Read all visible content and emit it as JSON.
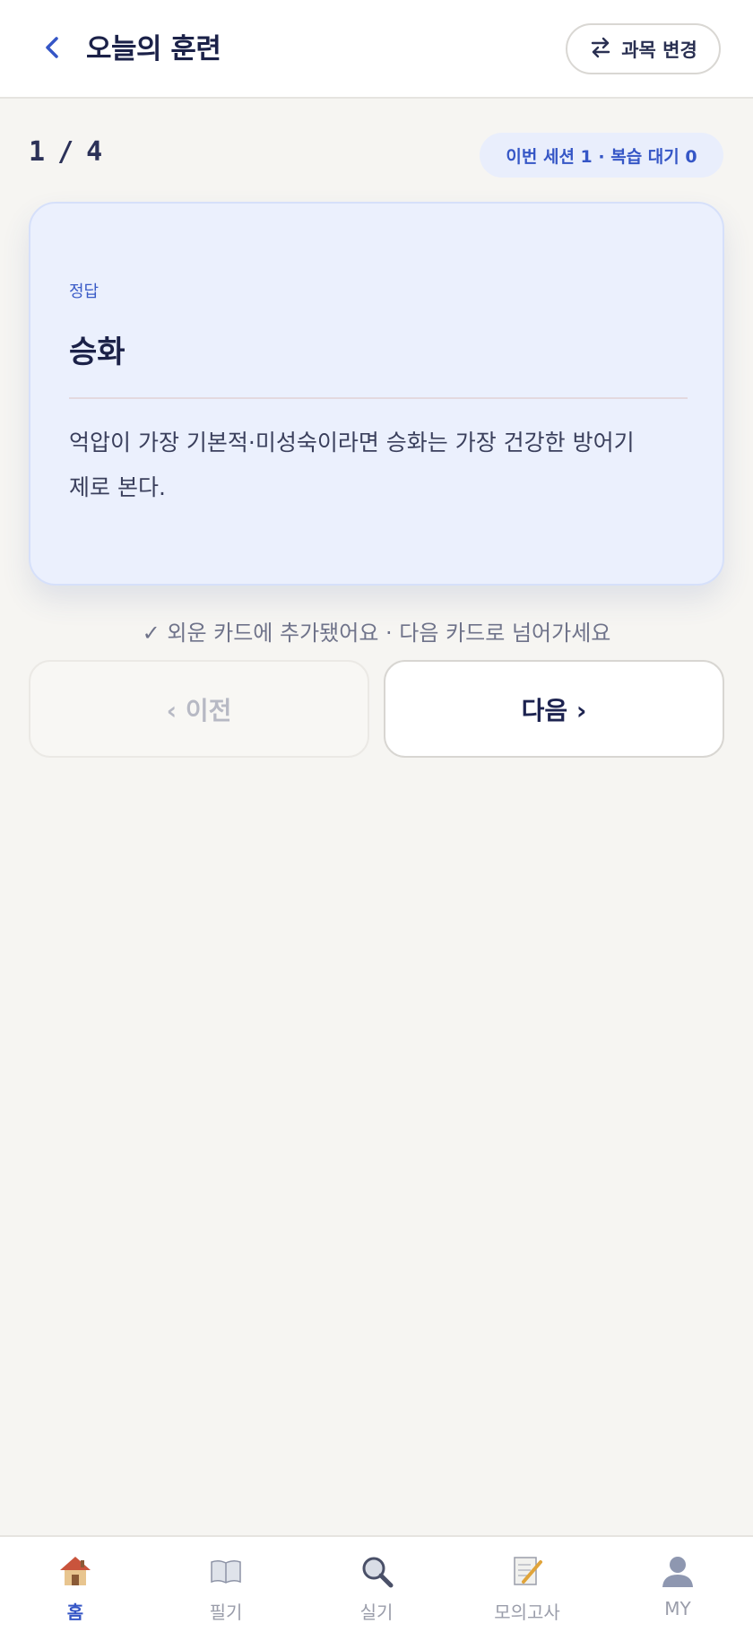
{
  "header": {
    "title": "오늘의 훈련",
    "change_subject_label": "과목 변경"
  },
  "progress": {
    "current": "1",
    "separator": "/",
    "total": "4",
    "session_badge": "이번 세션 1 · 복습 대기 0"
  },
  "card": {
    "label": "정답",
    "term": "승화",
    "explanation": "억압이 가장 기본적·미성숙이라면 승화는 가장 건강한 방어기제로 본다."
  },
  "feedback": "✓ 외운 카드에 추가됐어요 · 다음 카드로 넘어가세요",
  "nav": {
    "prev_label": "‹ 이전",
    "next_label": "다음 ›"
  },
  "tabs": [
    {
      "label": "홈",
      "icon": "home-icon",
      "active": true
    },
    {
      "label": "필기",
      "icon": "book-icon",
      "active": false
    },
    {
      "label": "실기",
      "icon": "magnifier-icon",
      "active": false
    },
    {
      "label": "모의고사",
      "icon": "memo-icon",
      "active": false
    },
    {
      "label": "MY",
      "icon": "user-icon",
      "active": false
    }
  ],
  "colors": {
    "accent": "#3556c6",
    "card_bg": "#ebf0fd",
    "page_bg": "#f6f5f2"
  }
}
